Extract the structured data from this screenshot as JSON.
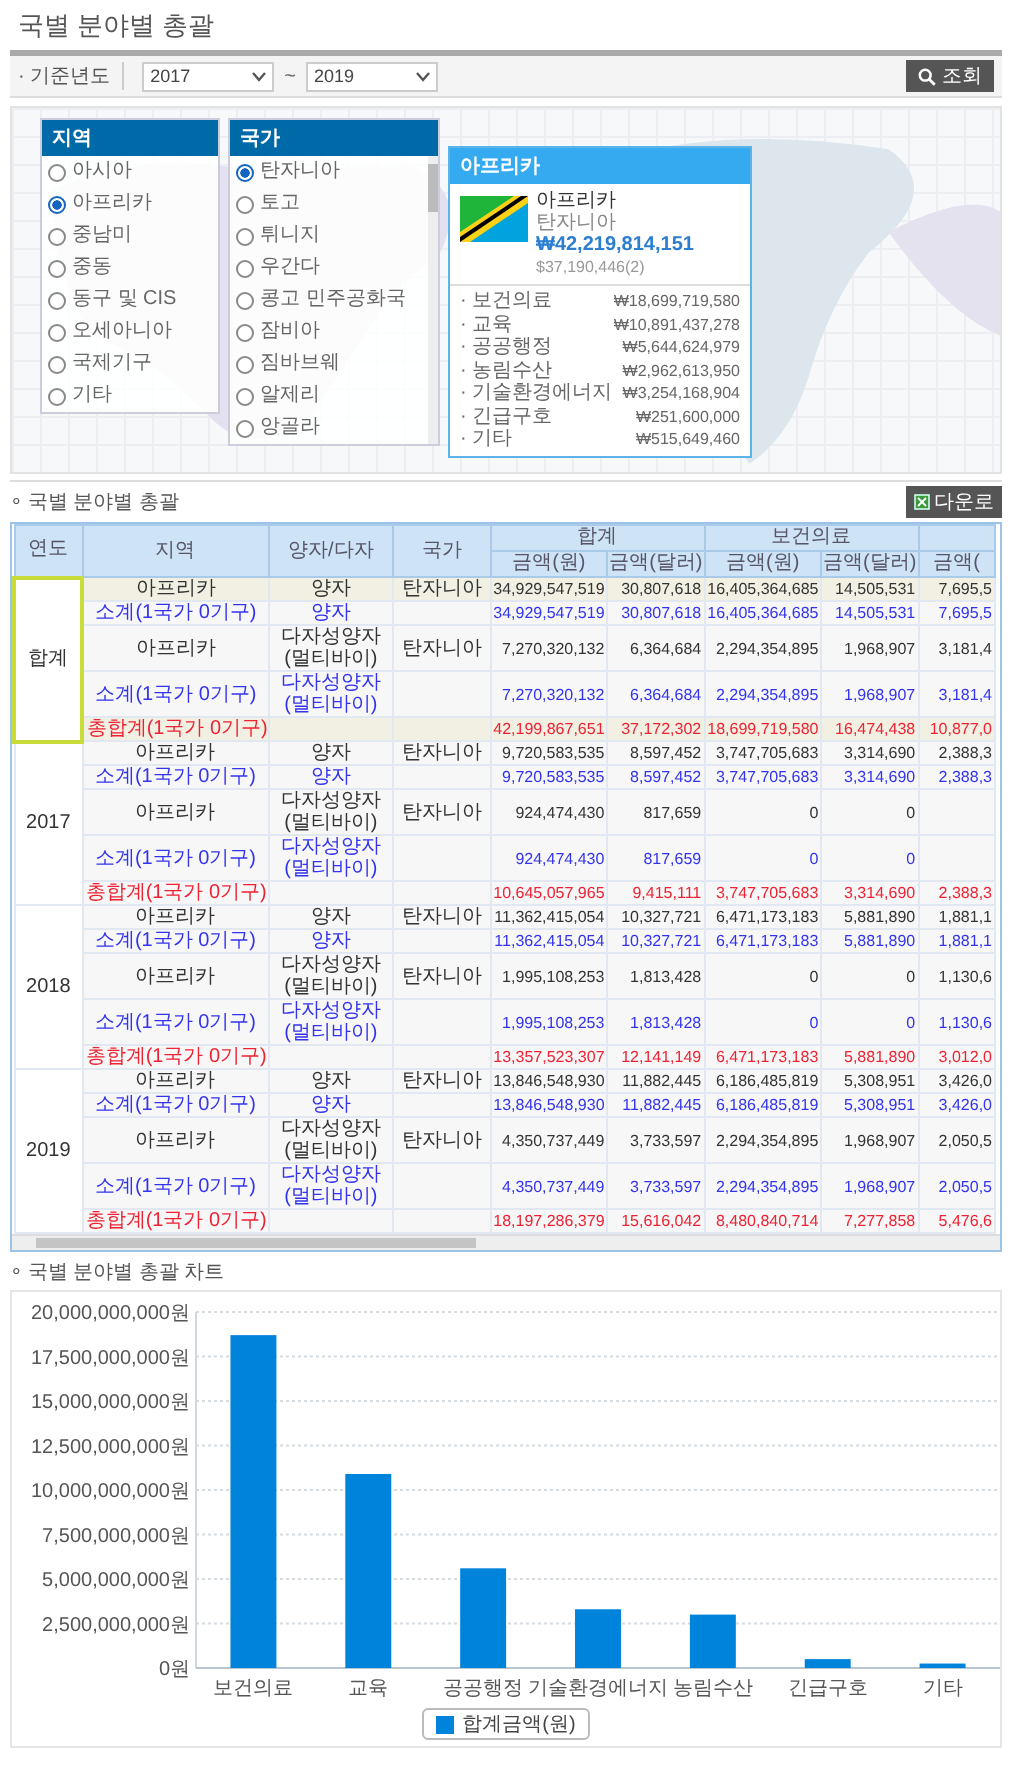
{
  "page_title": "국별 분야별 총괄",
  "filter": {
    "label": "· 기준년도",
    "from": "2017",
    "separator": "~",
    "to": "2019",
    "search_button": "조회"
  },
  "map": {
    "region_panel": {
      "title": "지역",
      "items": [
        {
          "label": "아시아",
          "selected": false
        },
        {
          "label": "아프리카",
          "selected": true
        },
        {
          "label": "중남미",
          "selected": false
        },
        {
          "label": "중동",
          "selected": false
        },
        {
          "label": "동구 및 CIS",
          "selected": false
        },
        {
          "label": "오세아니아",
          "selected": false
        },
        {
          "label": "국제기구",
          "selected": false
        },
        {
          "label": "기타",
          "selected": false
        }
      ]
    },
    "country_panel": {
      "title": "국가",
      "items": [
        {
          "label": "탄자니아",
          "selected": true
        },
        {
          "label": "토고",
          "selected": false
        },
        {
          "label": "튀니지",
          "selected": false
        },
        {
          "label": "우간다",
          "selected": false
        },
        {
          "label": "콩고 민주공화국",
          "selected": false
        },
        {
          "label": "잠비아",
          "selected": false
        },
        {
          "label": "짐바브웨",
          "selected": false
        },
        {
          "label": "알제리",
          "selected": false
        },
        {
          "label": "앙골라",
          "selected": false
        }
      ]
    },
    "tooltip": {
      "title": "아프리카",
      "region": "아프리카",
      "country": "탄자니아",
      "amount_krw": "₩42,219,814,151",
      "amount_usd": "$37,190,446(2)",
      "sectors": [
        {
          "name": "· 보건의료",
          "amount": "₩18,699,719,580"
        },
        {
          "name": "· 교육",
          "amount": "₩10,891,437,278"
        },
        {
          "name": "· 공공행정",
          "amount": "₩5,644,624,979"
        },
        {
          "name": "· 농림수산",
          "amount": "₩2,962,613,950"
        },
        {
          "name": "· 기술환경에너지",
          "amount": "₩3,254,168,904"
        },
        {
          "name": "· 긴급구호",
          "amount": "₩251,600,000"
        },
        {
          "name": "· 기타",
          "amount": "₩515,649,460"
        }
      ]
    }
  },
  "table": {
    "title": "∘ 국별 분야별 총괄",
    "download_button": "다운로",
    "headers": [
      {
        "label": "연도"
      },
      {
        "label": "지역"
      },
      {
        "label": "양자/다자"
      },
      {
        "label": "국가"
      },
      {
        "label": "합계",
        "sub": [
          "금액(원)",
          "금액(달러)"
        ]
      },
      {
        "label": "보건의료",
        "sub": [
          "금액(원)",
          "금액(달러)"
        ]
      },
      {
        "sub": [
          "금액("
        ]
      }
    ],
    "groups": [
      {
        "year": "합계",
        "selected": true,
        "rows": [
          {
            "kind": "detail",
            "region": "아프리카",
            "type": "양자",
            "country": "탄자니아",
            "values": [
              "34,929,547,519",
              "30,807,618",
              "16,405,364,685",
              "14,505,531",
              "7,695,5"
            ]
          },
          {
            "kind": "subtotal",
            "region": "소계(1국가 0기구)",
            "type": "양자",
            "values": [
              "34,929,547,519",
              "30,807,618",
              "16,405,364,685",
              "14,505,531",
              "7,695,5"
            ]
          },
          {
            "kind": "detail",
            "region": "아프리카",
            "type": "다자성양자(멀티바이)",
            "country": "탄자니아",
            "values": [
              "7,270,320,132",
              "6,364,684",
              "2,294,354,895",
              "1,968,907",
              "3,181,4"
            ]
          },
          {
            "kind": "subtotal",
            "region": "소계(1국가 0기구)",
            "type": "다자성양자(멀티바이)",
            "values": [
              "7,270,320,132",
              "6,364,684",
              "2,294,354,895",
              "1,968,907",
              "3,181,4"
            ]
          },
          {
            "kind": "total",
            "region": "총합계(1국가 0기구)",
            "values": [
              "42,199,867,651",
              "37,172,302",
              "18,699,719,580",
              "16,474,438",
              "10,877,0"
            ]
          }
        ]
      },
      {
        "year": "2017",
        "selected": false,
        "rows": [
          {
            "kind": "detail",
            "region": "아프리카",
            "type": "양자",
            "country": "탄자니아",
            "values": [
              "9,720,583,535",
              "8,597,452",
              "3,747,705,683",
              "3,314,690",
              "2,388,3"
            ]
          },
          {
            "kind": "subtotal",
            "region": "소계(1국가 0기구)",
            "type": "양자",
            "values": [
              "9,720,583,535",
              "8,597,452",
              "3,747,705,683",
              "3,314,690",
              "2,388,3"
            ]
          },
          {
            "kind": "detail",
            "region": "아프리카",
            "type": "다자성양자(멀티바이)",
            "country": "탄자니아",
            "values": [
              "924,474,430",
              "817,659",
              "0",
              "0"
            ]
          },
          {
            "kind": "subtotal",
            "region": "소계(1국가 0기구)",
            "type": "다자성양자(멀티바이)",
            "values": [
              "924,474,430",
              "817,659",
              "0",
              "0"
            ]
          },
          {
            "kind": "total",
            "region": "총합계(1국가 0기구)",
            "values": [
              "10,645,057,965",
              "9,415,111",
              "3,747,705,683",
              "3,314,690",
              "2,388,3"
            ]
          }
        ]
      },
      {
        "year": "2018",
        "selected": false,
        "rows": [
          {
            "kind": "detail",
            "region": "아프리카",
            "type": "양자",
            "country": "탄자니아",
            "values": [
              "11,362,415,054",
              "10,327,721",
              "6,471,173,183",
              "5,881,890",
              "1,881,1"
            ]
          },
          {
            "kind": "subtotal",
            "region": "소계(1국가 0기구)",
            "type": "양자",
            "values": [
              "11,362,415,054",
              "10,327,721",
              "6,471,173,183",
              "5,881,890",
              "1,881,1"
            ]
          },
          {
            "kind": "detail",
            "region": "아프리카",
            "type": "다자성양자(멀티바이)",
            "country": "탄자니아",
            "values": [
              "1,995,108,253",
              "1,813,428",
              "0",
              "0",
              "1,130,6"
            ]
          },
          {
            "kind": "subtotal",
            "region": "소계(1국가 0기구)",
            "type": "다자성양자(멀티바이)",
            "values": [
              "1,995,108,253",
              "1,813,428",
              "0",
              "0",
              "1,130,6"
            ]
          },
          {
            "kind": "total",
            "region": "총합계(1국가 0기구)",
            "values": [
              "13,357,523,307",
              "12,141,149",
              "6,471,173,183",
              "5,881,890",
              "3,012,0"
            ]
          }
        ]
      },
      {
        "year": "2019",
        "selected": false,
        "rows": [
          {
            "kind": "detail",
            "region": "아프리카",
            "type": "양자",
            "country": "탄자니아",
            "values": [
              "13,846,548,930",
              "11,882,445",
              "6,186,485,819",
              "5,308,951",
              "3,426,0"
            ]
          },
          {
            "kind": "subtotal",
            "region": "소계(1국가 0기구)",
            "type": "양자",
            "values": [
              "13,846,548,930",
              "11,882,445",
              "6,186,485,819",
              "5,308,951",
              "3,426,0"
            ]
          },
          {
            "kind": "detail",
            "region": "아프리카",
            "type": "다자성양자(멀티바이)",
            "country": "탄자니아",
            "values": [
              "4,350,737,449",
              "3,733,597",
              "2,294,354,895",
              "1,968,907",
              "2,050,5"
            ]
          },
          {
            "kind": "subtotal",
            "region": "소계(1국가 0기구)",
            "type": "다자성양자(멀티바이)",
            "values": [
              "4,350,737,449",
              "3,733,597",
              "2,294,354,895",
              "1,968,907",
              "2,050,5"
            ]
          },
          {
            "kind": "total",
            "region": "총합계(1국가 0기구)",
            "values": [
              "18,197,286,379",
              "15,616,042",
              "8,480,840,714",
              "7,277,858",
              "5,476,6"
            ]
          }
        ]
      }
    ]
  },
  "chart": {
    "title": "∘ 국별 분야별 총괄 차트",
    "chart_data": {
      "type": "bar",
      "grid": true,
      "categories": [
        "보건의료",
        "교육",
        "공공행정",
        "기술환경에너지",
        "농림수산",
        "긴급구호",
        "기타"
      ],
      "series": [
        {
          "name": "합계금액(원)",
          "color": "#0083db",
          "values": [
            18700000000,
            10900000000,
            5600000000,
            3300000000,
            3000000000,
            500000000,
            250000000
          ]
        }
      ],
      "ylim": [
        0,
        20000000000
      ],
      "yticks": [
        {
          "value": 0,
          "label": "0원"
        },
        {
          "value": 2500000000,
          "label": "2,500,000,000원"
        },
        {
          "value": 5000000000,
          "label": "5,000,000,000원"
        },
        {
          "value": 7500000000,
          "label": "7,500,000,000원"
        },
        {
          "value": 10000000000,
          "label": "10,000,000,000원"
        },
        {
          "value": 12500000000,
          "label": "12,500,000,000원"
        },
        {
          "value": 15000000000,
          "label": "15,000,000,000원"
        },
        {
          "value": 17500000000,
          "label": "17,500,000,000원"
        },
        {
          "value": 20000000000,
          "label": "20,000,000,000원"
        }
      ]
    }
  }
}
